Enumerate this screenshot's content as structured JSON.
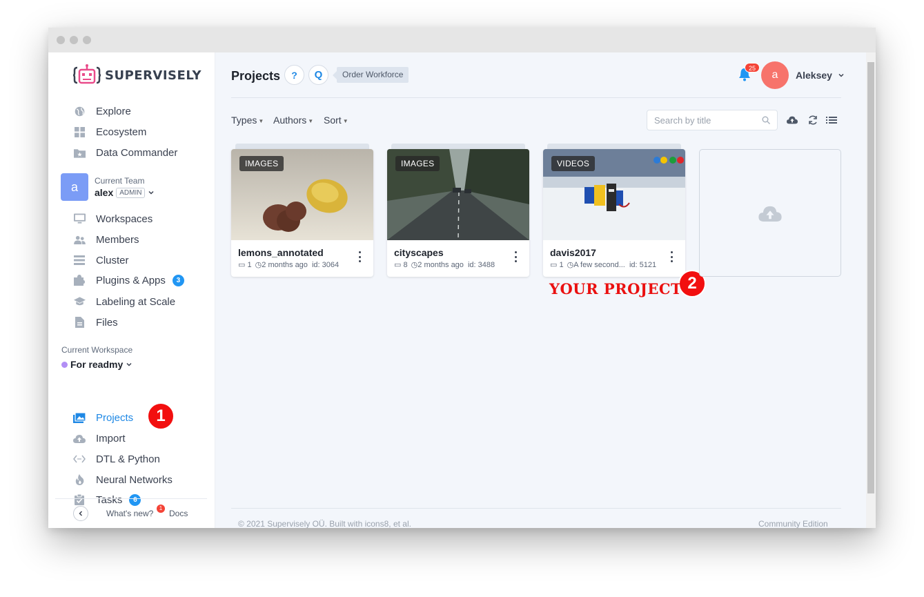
{
  "brand": {
    "name": "SUPERVISELY"
  },
  "sidebar": {
    "top_items": [
      {
        "label": "Explore",
        "icon": "globe-icon"
      },
      {
        "label": "Ecosystem",
        "icon": "grid-icon"
      },
      {
        "label": "Data Commander",
        "icon": "folder-star-icon"
      }
    ],
    "team": {
      "caption": "Current Team",
      "avatar_letter": "a",
      "name": "alex",
      "role": "ADMIN"
    },
    "team_items": [
      {
        "label": "Workspaces",
        "icon": "monitor-icon"
      },
      {
        "label": "Members",
        "icon": "people-icon"
      },
      {
        "label": "Cluster",
        "icon": "server-icon"
      },
      {
        "label": "Plugins & Apps",
        "icon": "puzzle-icon",
        "badge": "3"
      },
      {
        "label": "Labeling at Scale",
        "icon": "graduation-cap-icon"
      },
      {
        "label": "Files",
        "icon": "file-icon"
      }
    ],
    "workspace": {
      "caption": "Current Workspace",
      "name": "For readmy",
      "dot_color": "#b28ef5"
    },
    "workspace_items": [
      {
        "label": "Projects",
        "icon": "images-icon",
        "active": true
      },
      {
        "label": "Import",
        "icon": "cloud-upload-icon"
      },
      {
        "label": "DTL & Python",
        "icon": "code-icon"
      },
      {
        "label": "Neural Networks",
        "icon": "flame-icon"
      },
      {
        "label": "Tasks",
        "icon": "clipboard-check-icon",
        "badge": "6"
      }
    ],
    "footer": {
      "whats_new": "What's new?",
      "whats_new_badge": "1",
      "docs": "Docs"
    }
  },
  "annotations": {
    "marker_1": "1",
    "marker_2": "2",
    "your_project": "YOUR PROJECT"
  },
  "header": {
    "title": "Projects",
    "help_label": "?",
    "q_label": "Q",
    "order_workforce": "Order Workforce",
    "notifications": "25",
    "user_avatar_letter": "a",
    "user_name": "Aleksey"
  },
  "filters": {
    "types": "Types",
    "authors": "Authors",
    "sort": "Sort"
  },
  "search": {
    "placeholder": "Search by title",
    "value": ""
  },
  "projects": [
    {
      "type": "IMAGES",
      "title": "lemons_annotated",
      "items": "1",
      "updated": "2 months ago",
      "id": "id: 3064"
    },
    {
      "type": "IMAGES",
      "title": "cityscapes",
      "items": "8",
      "updated": "2 months ago",
      "id": "id: 3488"
    },
    {
      "type": "VIDEOS",
      "title": "davis2017",
      "items": "1",
      "updated": "A few second...",
      "id": "id: 5121"
    }
  ],
  "footer": {
    "copyright": "© 2021 Supervisely OÜ. Built with icons8, et al.",
    "edition": "Community Edition"
  },
  "colors": {
    "accent": "#1e88e5",
    "marker_red": "#f20f0f",
    "team_avatar": "#7b9cf6",
    "user_avatar": "#f7736b"
  }
}
